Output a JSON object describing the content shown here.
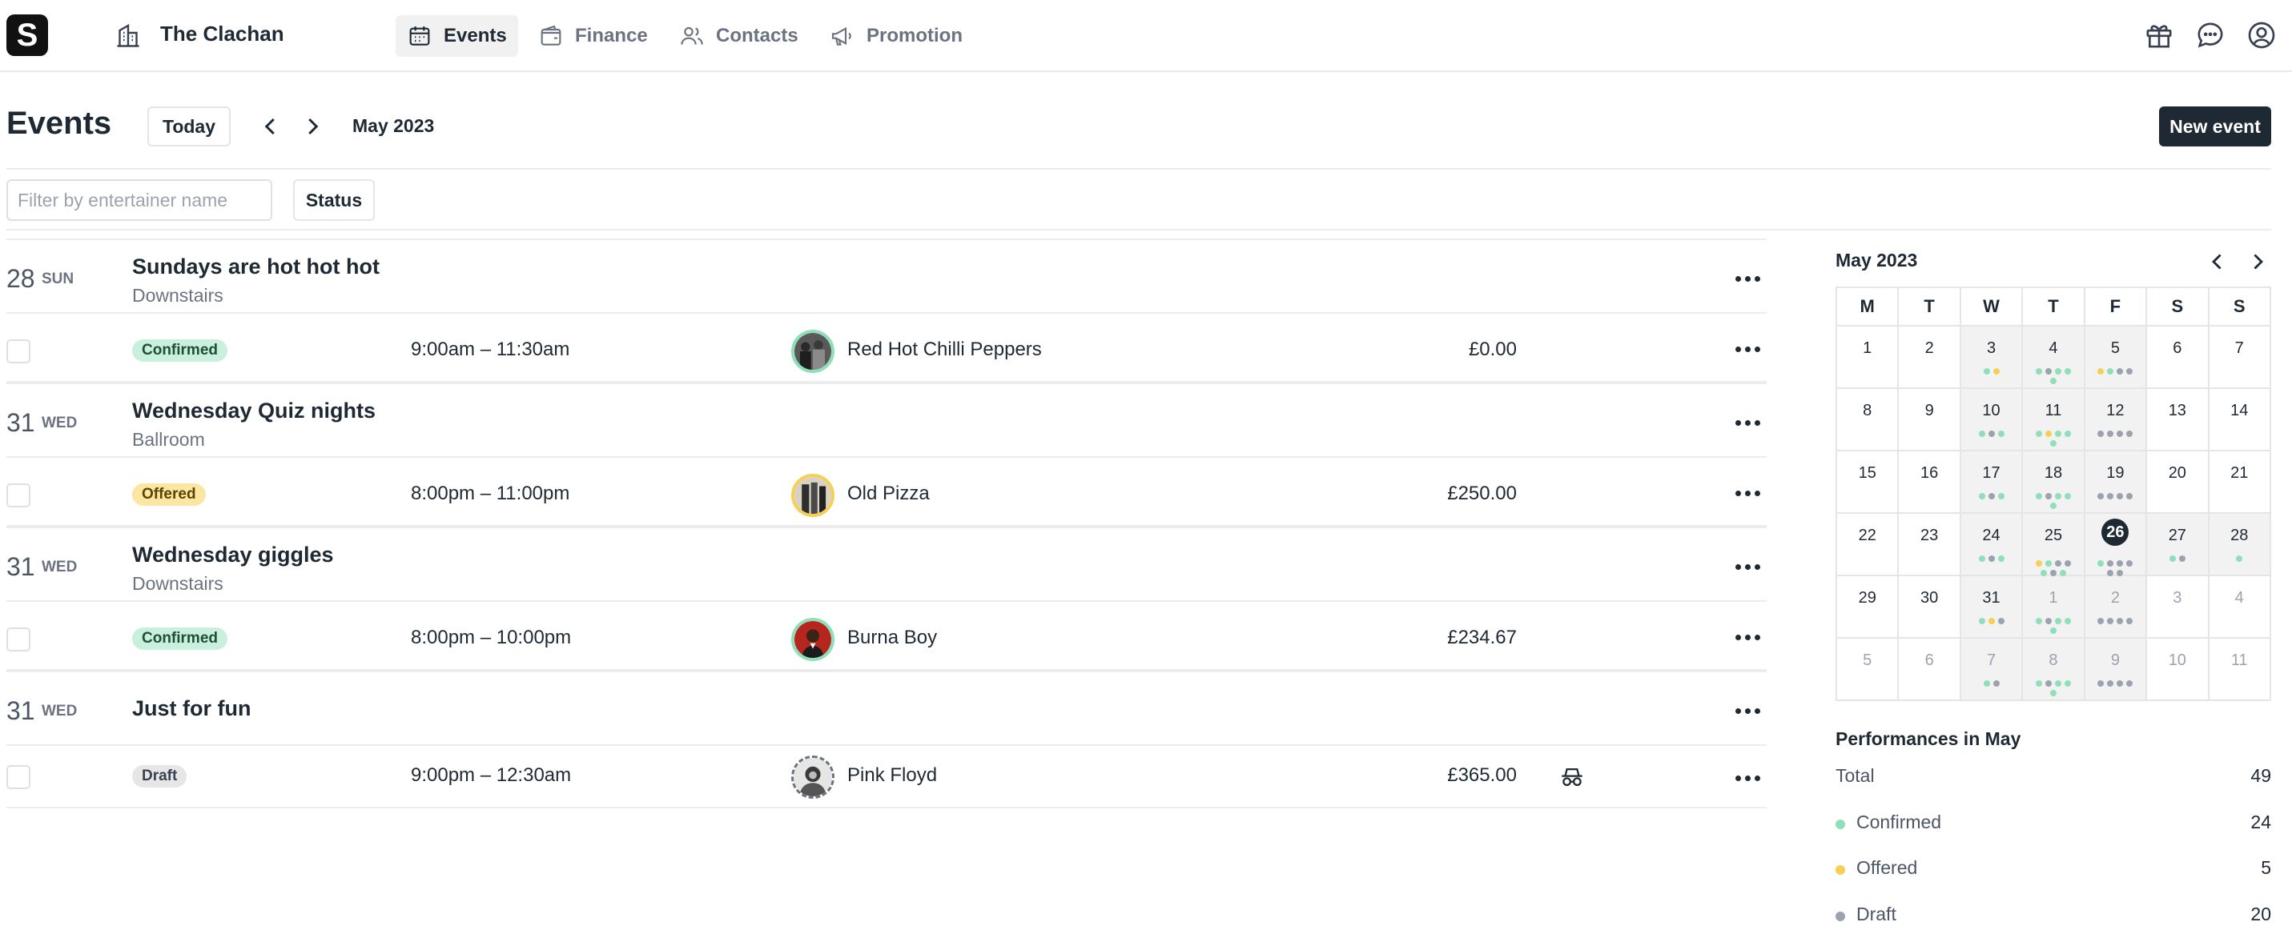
{
  "nav": {
    "logo": "S",
    "venue": "The Clachan",
    "items": [
      {
        "label": "Events",
        "active": true
      },
      {
        "label": "Finance",
        "active": false
      },
      {
        "label": "Contacts",
        "active": false
      },
      {
        "label": "Promotion",
        "active": false
      }
    ],
    "right_icons": [
      "gift-icon",
      "chat-icon",
      "account-icon"
    ]
  },
  "header": {
    "title": "Events",
    "today_label": "Today",
    "month": "May 2023",
    "new_event_label": "New event"
  },
  "filters": {
    "search_placeholder": "Filter by entertainer name",
    "status_label": "Status"
  },
  "events": [
    {
      "day": "28",
      "weekday": "SUN",
      "title": "Sundays are hot hot hot",
      "room": "Downstairs",
      "performance": {
        "status": "Confirmed",
        "time": "9:00am – 11:30am",
        "entertainer": "Red Hot Chilli Peppers",
        "fee": "£0.00"
      }
    },
    {
      "day": "31",
      "weekday": "WED",
      "title": "Wednesday Quiz nights",
      "room": "Ballroom",
      "performance": {
        "status": "Offered",
        "time": "8:00pm – 11:00pm",
        "entertainer": "Old Pizza",
        "fee": "£250.00"
      }
    },
    {
      "day": "31",
      "weekday": "WED",
      "title": "Wednesday giggles",
      "room": "Downstairs",
      "performance": {
        "status": "Confirmed",
        "time": "8:00pm – 10:00pm",
        "entertainer": "Burna Boy",
        "fee": "£234.67"
      }
    },
    {
      "day": "31",
      "weekday": "WED",
      "title": "Just for fun",
      "room": "",
      "performance": {
        "status": "Draft",
        "time": "9:00pm – 12:30am",
        "entertainer": "Pink Floyd",
        "fee": "£365.00",
        "private": true
      }
    }
  ],
  "calendar": {
    "month": "May 2023",
    "weekdays": [
      "M",
      "T",
      "W",
      "T",
      "F",
      "S",
      "S"
    ],
    "weeks": [
      [
        "1",
        "2",
        "3",
        "4",
        "5",
        "6",
        "7"
      ],
      [
        "8",
        "9",
        "10",
        "11",
        "12",
        "13",
        "14"
      ],
      [
        "15",
        "16",
        "17",
        "18",
        "19",
        "20",
        "21"
      ],
      [
        "22",
        "23",
        "24",
        "25",
        "26",
        "27",
        "28"
      ],
      [
        "29",
        "30",
        "31",
        "1",
        "2",
        "3",
        "4"
      ],
      [
        "5",
        "6",
        "7",
        "8",
        "9",
        "10",
        "11"
      ]
    ],
    "today": "26"
  },
  "summary": {
    "title": "Performances in May",
    "total_label": "Total",
    "total": "49",
    "confirmed_label": "Confirmed",
    "confirmed": "24",
    "offered_label": "Offered",
    "offered": "5",
    "draft_label": "Draft",
    "draft": "20"
  },
  "colors": {
    "confirmed": "#8fe0b9",
    "offered": "#f6cf57",
    "draft": "#9ca3af",
    "primary": "#1f2933"
  }
}
